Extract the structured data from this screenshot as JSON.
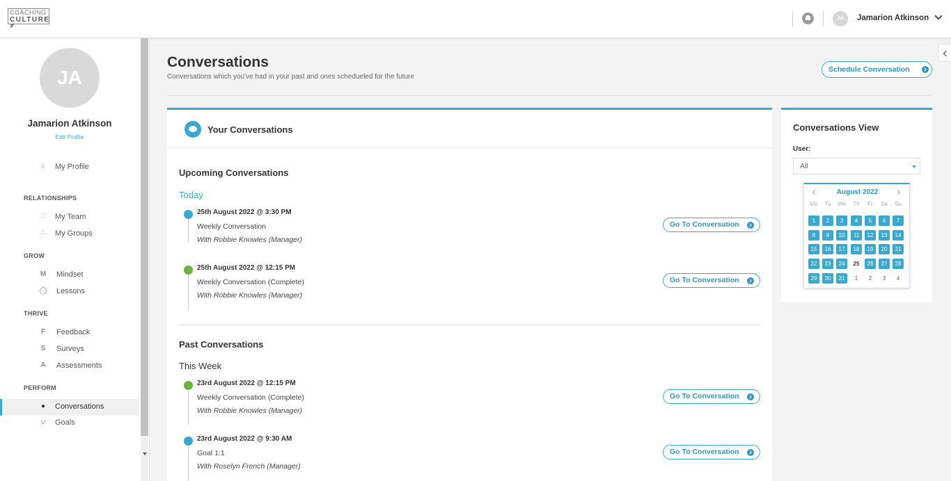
{
  "topbar": {
    "logo_line1": "COACHING",
    "logo_line2": "CULTURE",
    "avatar_initials": "JA",
    "user_name": "Jamarion Atkinson"
  },
  "sidebar": {
    "avatar_initials": "JA",
    "name": "Jamarion Atkinson",
    "edit_profile": "Edit Profile",
    "profile_item": {
      "icon": "home-icon",
      "label": "My Profile"
    },
    "sections": {
      "relationships": "RELATIONSHIPS",
      "grow": "GROW",
      "thrive": "THRIVE",
      "perform": "PERFORM"
    },
    "items": {
      "my_team": {
        "icon": "team-icon",
        "label": "My Team"
      },
      "my_groups": {
        "icon": "groups-icon",
        "label": "My Groups"
      },
      "mindset": {
        "icon": "mindset-icon",
        "label": "Mindset"
      },
      "lessons": {
        "icon": "lessons-icon",
        "label": "Lessons"
      },
      "feedback": {
        "icon": "feedback-icon",
        "label": "Feedback"
      },
      "surveys": {
        "icon": "surveys-icon",
        "label": "Surveys"
      },
      "assessments": {
        "icon": "assessments-icon",
        "label": "Assessments"
      },
      "conversations": {
        "icon": "chat-icon",
        "label": "Conversations"
      },
      "goals": {
        "icon": "goals-icon",
        "label": "Goals"
      }
    }
  },
  "header": {
    "title": "Conversations",
    "subtitle": "Conversations which you've had in your past and ones schedueled for the future",
    "schedule_button": "Schedule Conversation"
  },
  "conversations": {
    "panel_title": "Your Conversations",
    "upcoming_title": "Upcoming Conversations",
    "upcoming_group": "Today",
    "past_title": "Past Conversations",
    "past_group": "This Week",
    "goto_label": "Go To Conversation",
    "upcoming": [
      {
        "date": "25th August 2022 @ 3:30 PM",
        "title": "Weekly Conversation",
        "with": "With Robbie Knowles (Manager)",
        "status": "blue"
      },
      {
        "date": "25th August 2022 @ 12:15 PM",
        "title": "Weekly Conversation (Complete)",
        "with": "With Robbie Knowles (Manager)",
        "status": "green"
      }
    ],
    "past": [
      {
        "date": "23rd August 2022 @ 12:15 PM",
        "title": "Weekly Conversation (Complete)",
        "with": "With Robbie Knowles (Manager)",
        "status": "green"
      },
      {
        "date": "23rd August 2022 @ 9:30 AM",
        "title": "Goal 1:1",
        "with": "With Roselyn French (Manager)",
        "status": "blue"
      }
    ]
  },
  "view": {
    "title": "Conversations View",
    "user_label": "User:",
    "user_value": "All",
    "calendar": {
      "month": "August 2022",
      "dow": [
        "Mo",
        "Tu",
        "We",
        "Th",
        "Fr",
        "Sa",
        "Su"
      ],
      "weeks": [
        [
          "1",
          "2",
          "3",
          "4",
          "5",
          "6",
          "7"
        ],
        [
          "8",
          "9",
          "10",
          "11",
          "12",
          "13",
          "14"
        ],
        [
          "15",
          "16",
          "17",
          "18",
          "19",
          "20",
          "21"
        ],
        [
          "22",
          "23",
          "24",
          "25",
          "26",
          "27",
          "28"
        ],
        [
          "29",
          "30",
          "31",
          "1",
          "2",
          "3",
          "4"
        ]
      ],
      "today": "25"
    }
  },
  "colors": {
    "accent": "#3ba8d0",
    "complete": "#6cb33f"
  }
}
